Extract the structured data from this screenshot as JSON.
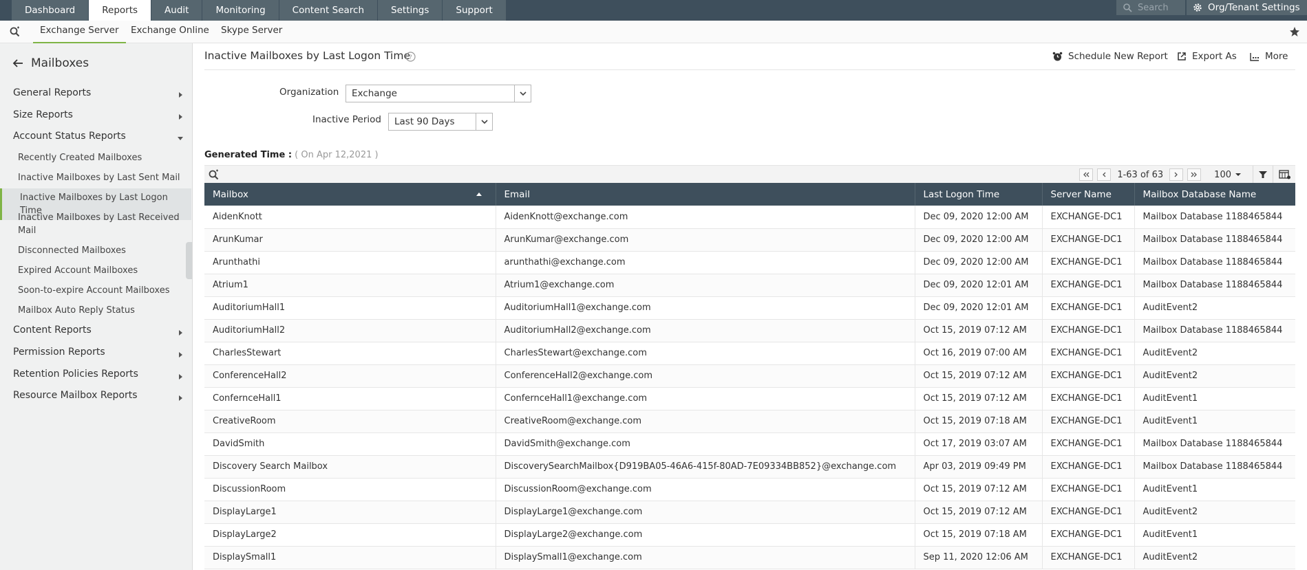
{
  "topnav": {
    "tabs": [
      {
        "label": "Dashboard",
        "active": false
      },
      {
        "label": "Reports",
        "active": true
      },
      {
        "label": "Audit",
        "active": false
      },
      {
        "label": "Monitoring",
        "active": false
      },
      {
        "label": "Content Search",
        "active": false
      },
      {
        "label": "Settings",
        "active": false
      },
      {
        "label": "Support",
        "active": false
      }
    ],
    "search_placeholder": "Search",
    "org_settings_label": "Org/Tenant Settings"
  },
  "subnav": {
    "tabs": [
      {
        "label": "Exchange Server",
        "active": true
      },
      {
        "label": "Exchange Online",
        "active": false
      },
      {
        "label": "Skype Server",
        "active": false
      }
    ]
  },
  "sidebar": {
    "title": "Mailboxes",
    "categories": {
      "general": "General Reports",
      "size": "Size Reports",
      "account_status": "Account Status Reports",
      "content": "Content Reports",
      "permission": "Permission Reports",
      "retention": "Retention Policies Reports",
      "resource": "Resource Mailbox Reports"
    },
    "account_status_items": [
      "Recently Created Mailboxes",
      "Inactive Mailboxes by Last Sent Mail",
      "Inactive Mailboxes by Last Logon Time",
      "Inactive Mailboxes by Last Received Mail",
      "Disconnected Mailboxes",
      "Expired Account Mailboxes",
      "Soon-to-expire Account Mailboxes",
      "Mailbox Auto Reply Status"
    ]
  },
  "report": {
    "title": "Inactive Mailboxes by Last Logon Time",
    "actions": {
      "schedule": "Schedule New Report",
      "export": "Export As",
      "more": "More"
    },
    "filters": {
      "organization_label": "Organization",
      "organization_value": "Exchange",
      "inactive_period_label": "Inactive Period",
      "inactive_period_value": "Last 90 Days"
    },
    "generated_label": "Generated Time :",
    "generated_value": "( On Apr 12,2021 )",
    "pager": {
      "range": "1-63 of 63",
      "page_size": "100"
    }
  },
  "table": {
    "columns": [
      "Mailbox",
      "Email",
      "Last Logon Time",
      "Server Name",
      "Mailbox Database Name"
    ],
    "rows": [
      [
        "AidenKnott",
        "AidenKnott@exchange.com",
        "Dec 09, 2020 12:00 AM",
        "EXCHANGE-DC1",
        "Mailbox Database 1188465844"
      ],
      [
        "ArunKumar",
        "ArunKumar@exchange.com",
        "Dec 09, 2020 12:00 AM",
        "EXCHANGE-DC1",
        "Mailbox Database 1188465844"
      ],
      [
        "Arunthathi",
        "arunthathi@exchange.com",
        "Dec 09, 2020 12:00 AM",
        "EXCHANGE-DC1",
        "Mailbox Database 1188465844"
      ],
      [
        "Atrium1",
        "Atrium1@exchange.com",
        "Dec 09, 2020 12:01 AM",
        "EXCHANGE-DC1",
        "Mailbox Database 1188465844"
      ],
      [
        "AuditoriumHall1",
        "AuditoriumHall1@exchange.com",
        "Dec 09, 2020 12:01 AM",
        "EXCHANGE-DC1",
        "AuditEvent2"
      ],
      [
        "AuditoriumHall2",
        "AuditoriumHall2@exchange.com",
        "Oct 15, 2019 07:12 AM",
        "EXCHANGE-DC1",
        "Mailbox Database 1188465844"
      ],
      [
        "CharlesStewart",
        "CharlesStewart@exchange.com",
        "Oct 16, 2019 07:00 AM",
        "EXCHANGE-DC1",
        "AuditEvent2"
      ],
      [
        "ConferenceHall2",
        "ConferenceHall2@exchange.com",
        "Oct 15, 2019 07:12 AM",
        "EXCHANGE-DC1",
        "AuditEvent2"
      ],
      [
        "ConfernceHall1",
        "ConfernceHall1@exchange.com",
        "Oct 15, 2019 07:12 AM",
        "EXCHANGE-DC1",
        "AuditEvent1"
      ],
      [
        "CreativeRoom",
        "CreativeRoom@exchange.com",
        "Oct 15, 2019 07:18 AM",
        "EXCHANGE-DC1",
        "AuditEvent1"
      ],
      [
        "DavidSmith",
        "DavidSmith@exchange.com",
        "Oct 17, 2019 03:07 AM",
        "EXCHANGE-DC1",
        "Mailbox Database 1188465844"
      ],
      [
        "Discovery Search Mailbox",
        "DiscoverySearchMailbox{D919BA05-46A6-415f-80AD-7E09334BB852}@exchange.com",
        "Apr 03, 2019 09:49 PM",
        "EXCHANGE-DC1",
        "Mailbox Database 1188465844"
      ],
      [
        "DiscussionRoom",
        "DiscussionRoom@exchange.com",
        "Oct 15, 2019 07:12 AM",
        "EXCHANGE-DC1",
        "AuditEvent1"
      ],
      [
        "DisplayLarge1",
        "DisplayLarge1@exchange.com",
        "Oct 15, 2019 07:12 AM",
        "EXCHANGE-DC1",
        "AuditEvent2"
      ],
      [
        "DisplayLarge2",
        "DisplayLarge2@exchange.com",
        "Oct 15, 2019 07:18 AM",
        "EXCHANGE-DC1",
        "AuditEvent1"
      ],
      [
        "DisplaySmall1",
        "DisplaySmall1@exchange.com",
        "Sep 11, 2020 12:06 AM",
        "EXCHANGE-DC1",
        "AuditEvent2"
      ]
    ]
  }
}
